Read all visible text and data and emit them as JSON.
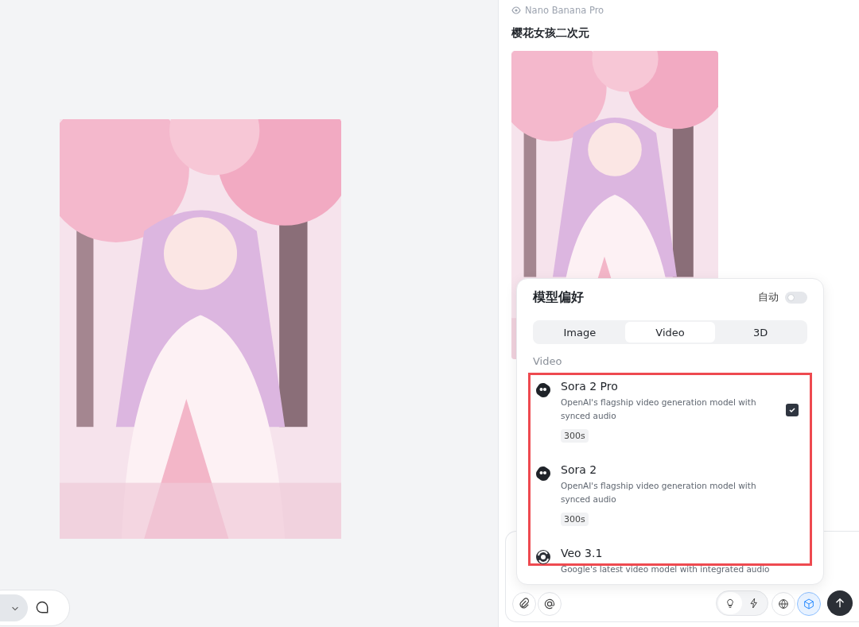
{
  "left_toolbar": {
    "items": [
      {
        "kind": "chevron",
        "selected": true
      },
      {
        "kind": "chat",
        "selected": false
      }
    ]
  },
  "chat": {
    "model_label": "Nano Banana Pro",
    "title": "樱花女孩二次元"
  },
  "popup": {
    "title": "模型偏好",
    "auto": {
      "label": "自动",
      "on": false
    },
    "tabs": [
      {
        "label": "Image",
        "selected": false
      },
      {
        "label": "Video",
        "selected": true
      },
      {
        "label": "3D",
        "selected": false
      }
    ],
    "section": "Video",
    "models": [
      {
        "kind": "blob",
        "name": "Sora 2 Pro",
        "description": "OpenAI's flagship video generation model with synced audio",
        "tag": "300s",
        "checked": true
      },
      {
        "kind": "blob",
        "name": "Sora 2",
        "description": "OpenAI's flagship video generation model with synced audio",
        "tag": "300s",
        "checked": false
      },
      {
        "kind": "swirl",
        "name": "Veo 3.1",
        "description": "Google's latest video model with integrated audio",
        "checked": false
      }
    ]
  },
  "composer": {
    "left_buttons": [
      {
        "kind": "attach"
      },
      {
        "kind": "mention"
      }
    ],
    "modes": [
      {
        "kind": "bulb",
        "selected": true
      },
      {
        "kind": "bolt",
        "selected": false
      }
    ],
    "right_buttons": [
      {
        "kind": "globe",
        "active": false
      },
      {
        "kind": "cube",
        "active": true
      }
    ],
    "send": {
      "kind": "send"
    }
  }
}
